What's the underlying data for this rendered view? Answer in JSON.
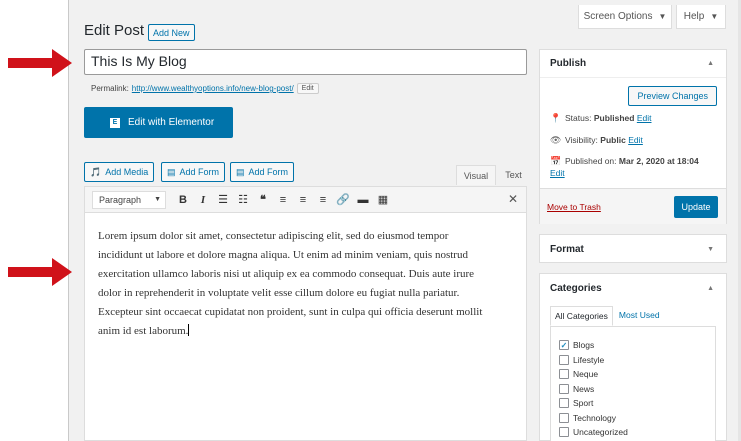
{
  "header": {
    "screen_options": "Screen Options",
    "help": "Help",
    "title": "Edit Post",
    "add_new": "Add New"
  },
  "post": {
    "title_value": "This Is My Blog",
    "permalink_label": "Permalink:",
    "permalink_url": "http://www.wealthyoptions.info/new-blog-post/",
    "permalink_edit": "Edit",
    "elementor_button": "Edit with Elementor"
  },
  "editor": {
    "add_media": "Add Media",
    "add_form_1": "Add Form",
    "add_form_2": "Add Form",
    "tab_visual": "Visual",
    "tab_text": "Text",
    "format_select": "Paragraph",
    "content_lines": [
      "Lorem ipsum dolor sit amet, consectetur adipiscing elit, sed do eiusmod tempor",
      "incididunt ut labore et dolore magna aliqua. Ut enim ad minim veniam, quis nostrud",
      "exercitation ullamco laboris nisi ut aliquip ex ea commodo consequat. Duis aute irure",
      "dolor in reprehenderit in voluptate velit esse cillum dolore eu fugiat nulla pariatur.",
      "Excepteur sint occaecat cupidatat non proident, sunt in culpa qui officia deserunt mollit",
      "anim id est laborum."
    ]
  },
  "publish": {
    "title": "Publish",
    "preview_changes": "Preview Changes",
    "status_label": "Status:",
    "status_value": "Published",
    "status_edit": "Edit",
    "visibility_label": "Visibility:",
    "visibility_value": "Public",
    "visibility_edit": "Edit",
    "published_on_label": "Published on:",
    "published_on_value": "Mar 2, 2020 at 18:04",
    "published_edit": "Edit",
    "move_to_trash": "Move to Trash",
    "update": "Update"
  },
  "format_box": {
    "title": "Format"
  },
  "categories": {
    "title": "Categories",
    "tab_all": "All Categories",
    "tab_most_used": "Most Used",
    "items": [
      {
        "label": "Blogs",
        "checked": true
      },
      {
        "label": "Lifestyle",
        "checked": false
      },
      {
        "label": "Neque",
        "checked": false
      },
      {
        "label": "News",
        "checked": false
      },
      {
        "label": "Sport",
        "checked": false
      },
      {
        "label": "Technology",
        "checked": false
      },
      {
        "label": "Uncategorized",
        "checked": false
      }
    ]
  },
  "colors": {
    "accent": "#0073aa",
    "arrow": "#d0121a",
    "trash": "#a00000",
    "background": "#f1f1f1"
  },
  "icons": {
    "arrows": "red-arrow-icon",
    "media": "media-icon",
    "form": "form-icon",
    "status": "pin-icon",
    "visibility": "eye-icon",
    "calendar": "calendar-icon"
  }
}
